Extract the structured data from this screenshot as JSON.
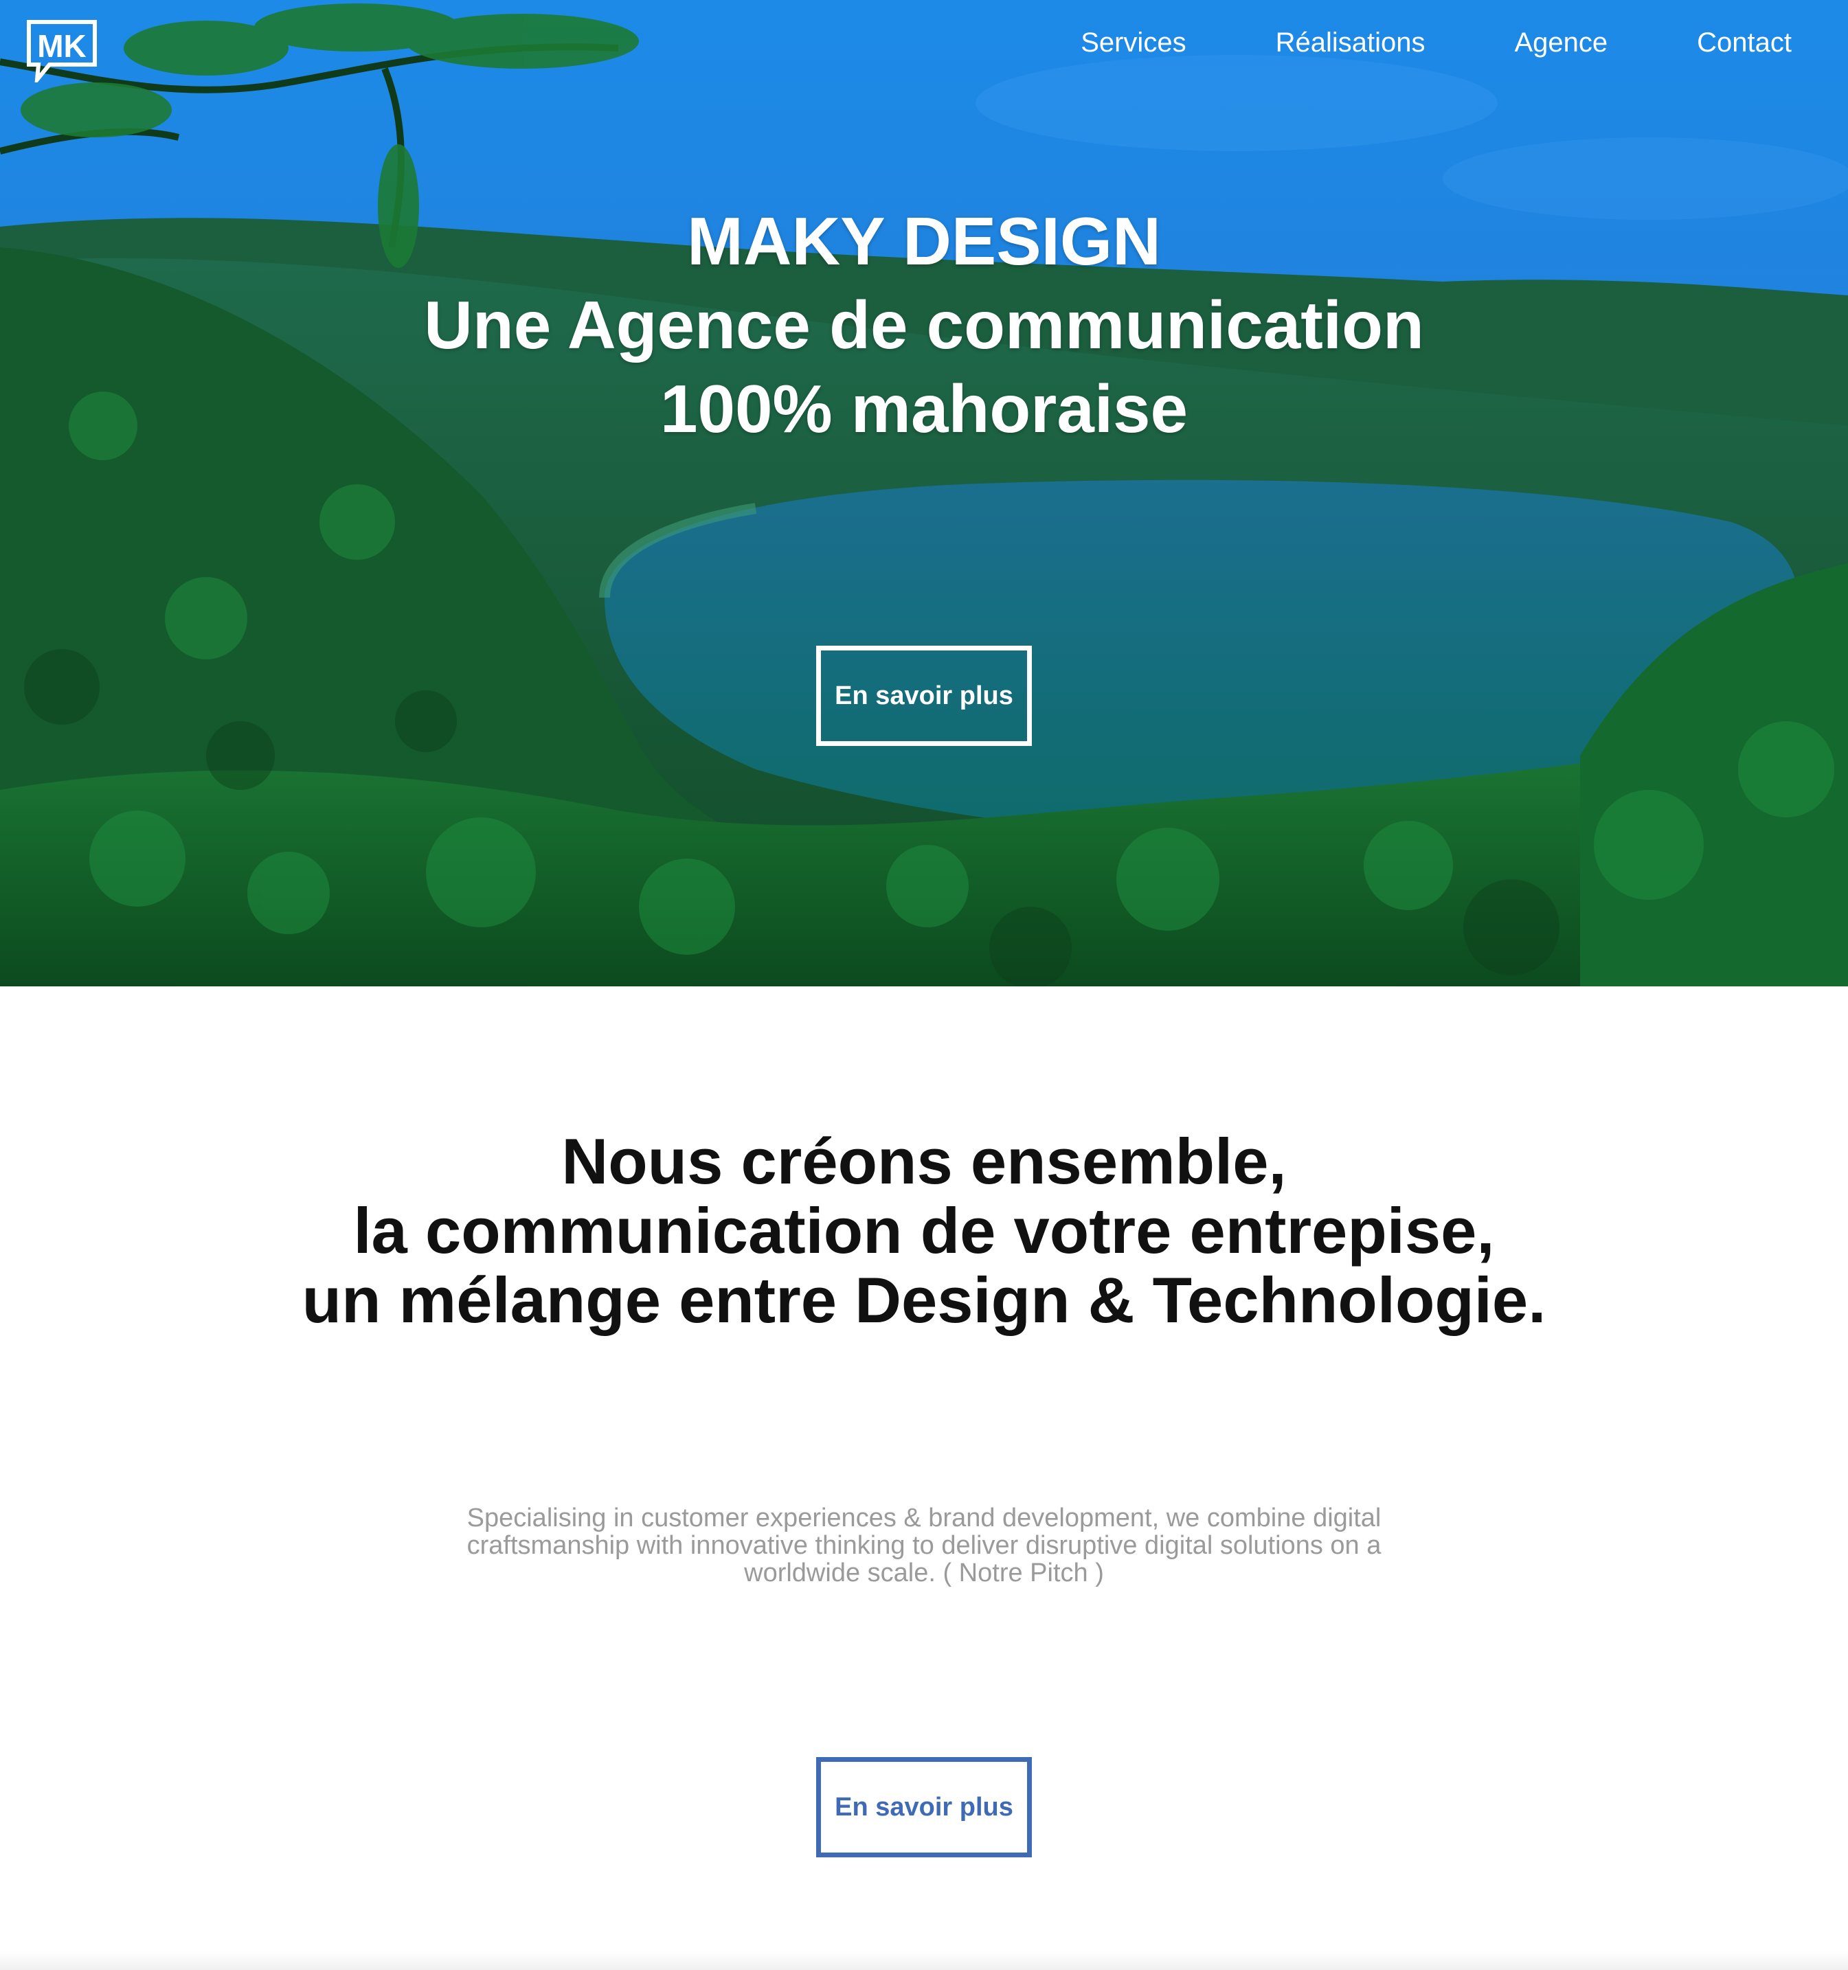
{
  "header": {
    "logo_text": "MK",
    "nav": [
      {
        "label": "Services"
      },
      {
        "label": "Réalisations"
      },
      {
        "label": "Agence"
      },
      {
        "label": "Contact"
      }
    ]
  },
  "hero": {
    "title_lines": [
      "MAKY DESIGN",
      "Une Agence de communication",
      "100% mahoraise"
    ],
    "button_label": "En savoir plus"
  },
  "content": {
    "headline_lines": [
      "Nous créons ensemble,",
      "la communication de votre entrepise,",
      "un mélange entre Design & Technologie."
    ],
    "pitch": "Specialising in customer experiences & brand development, we combine digital craftsmanship with innovative thinking to deliver disruptive digital solutions on a worldwide scale. ( Notre Pitch )",
    "button_label": "En savoir plus"
  },
  "colors": {
    "sky": "#1f86e6",
    "forest": "#14552c",
    "lake": "#137a8a",
    "accent_blue": "#3f6ab5",
    "pitch_gray": "#9a9a9a",
    "headline": "#111111"
  },
  "icons": {
    "logo": "mk-speech-bubble-logo"
  }
}
